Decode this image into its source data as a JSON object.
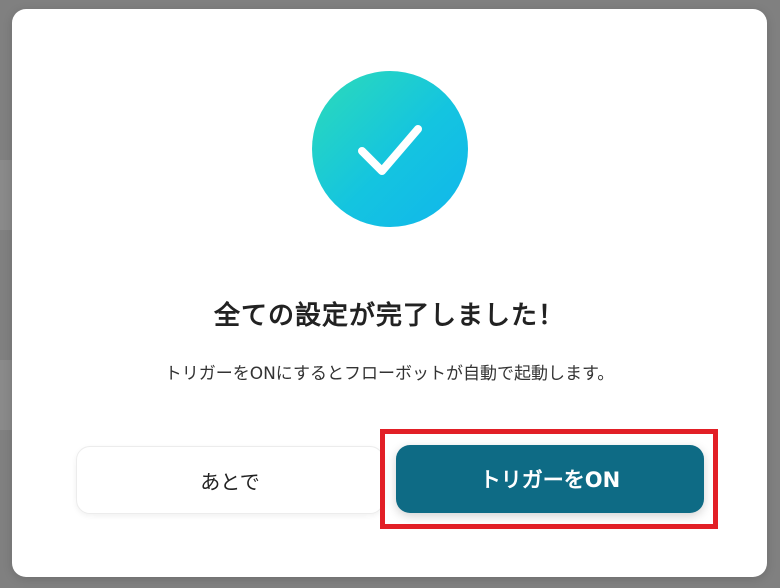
{
  "dialog": {
    "title": "全ての設定が完了しました！",
    "message": "トリガーをONにするとフローボットが自動で起動します。",
    "icon": "check-circle-icon",
    "icon_gradient": [
      "#2ddbb8",
      "#11b6ec"
    ]
  },
  "buttons": {
    "later_label": "あとで",
    "trigger_on_label": "トリガーをON",
    "trigger_on_color": "#0e6b85"
  },
  "highlight": {
    "color": "#e21f26"
  }
}
